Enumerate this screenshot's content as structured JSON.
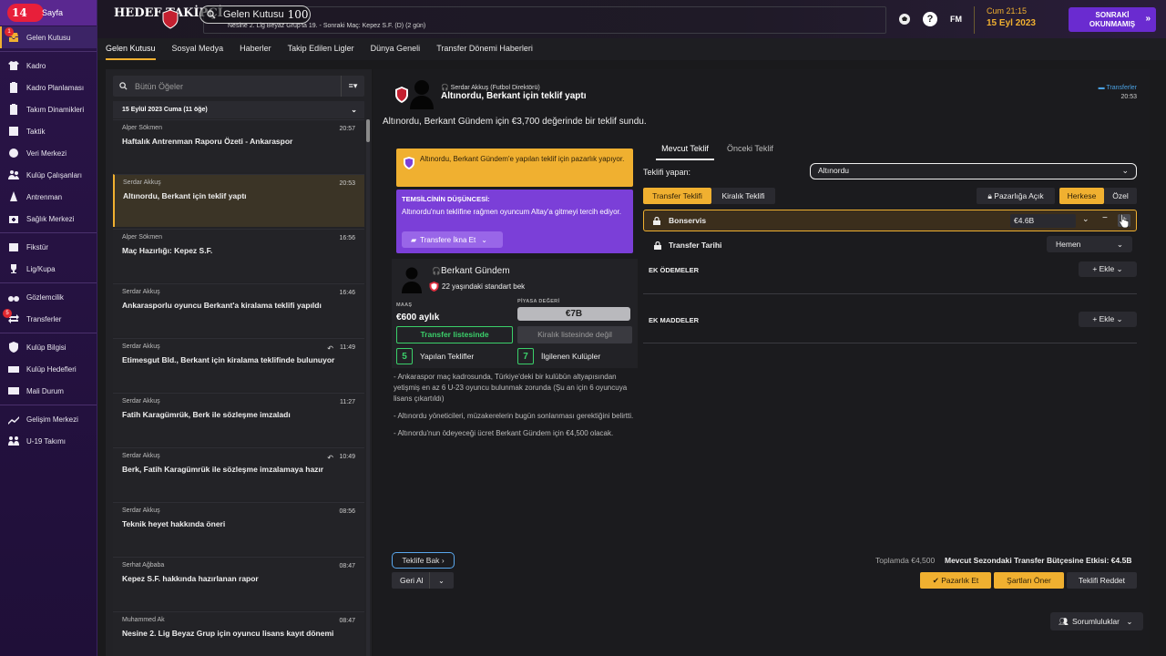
{
  "sidebar": {
    "page_badge": "14",
    "page_label": "Sayfa",
    "items": [
      {
        "label": "Gelen Kutusu",
        "icon": "inbox-icon",
        "badge": "1",
        "active": true
      },
      {
        "label": "Kadro",
        "icon": "shirt-icon"
      },
      {
        "label": "Kadro Planlaması",
        "icon": "clipboard-icon"
      },
      {
        "label": "Takım Dinamikleri",
        "icon": "clipboard-icon"
      },
      {
        "label": "Taktik",
        "icon": "tactics-board-icon"
      },
      {
        "label": "Veri Merkezi",
        "icon": "globe-icon"
      },
      {
        "label": "Kulüp Çalışanları",
        "icon": "staff-icon"
      },
      {
        "label": "Antrenman",
        "icon": "cone-icon"
      },
      {
        "label": "Sağlık Merkezi",
        "icon": "medical-icon"
      },
      {
        "label": "Fikstür",
        "icon": "calendar-icon"
      },
      {
        "label": "Lig/Kupa",
        "icon": "trophy-icon"
      },
      {
        "label": "Gözlemcilik",
        "icon": "binoculars-icon"
      },
      {
        "label": "Transferler",
        "icon": "transfer-icon",
        "badge": "5"
      },
      {
        "label": "Kulüp Bilgisi",
        "icon": "shield-icon"
      },
      {
        "label": "Kulüp Hedefleri",
        "icon": "board-icon"
      },
      {
        "label": "Mali Durum",
        "icon": "finance-icon"
      },
      {
        "label": "Gelişim Merkezi",
        "icon": "development-icon"
      },
      {
        "label": "U-19 Takımı",
        "icon": "youth-icon"
      }
    ]
  },
  "topbar": {
    "title": "HEDEF TAKİPÇİ",
    "search_label": "Gelen Kutusu",
    "search_count": "100",
    "subtitle": "Nesine 2. Lig Beyaz Grup'ta 19. - Sonraki Maç: Kepez S.F. (D) (2 gün)",
    "fm_label": "FM",
    "time": "Cum 21:15",
    "date": "15 Eyl 2023",
    "next_button": "SONRAKİ OKUNMAMIŞ",
    "accent": "#f0b030",
    "next_color": "#6a2bd0"
  },
  "tabs": [
    "Gelen Kutusu",
    "Sosyal Medya",
    "Haberler",
    "Takip Edilen Ligler",
    "Dünya Geneli",
    "Transfer Dönemi Haberleri"
  ],
  "inbox": {
    "search_placeholder": "Bütün Öğeler",
    "date_header": "15 Eylül 2023 Cuma (11 öğe)",
    "messages": [
      {
        "from": "Alper Sökmen",
        "time": "20:57",
        "subject": "Haftalık Antrenman Raporu Özeti - Ankaraspor"
      },
      {
        "from": "Serdar Akkuş",
        "time": "20:53",
        "subject": "Altınordu, Berkant için teklif yaptı",
        "selected": true
      },
      {
        "from": "Alper Sökmen",
        "time": "16:56",
        "subject": "Maç Hazırlığı: Kepez S.F."
      },
      {
        "from": "Serdar Akkuş",
        "time": "16:46",
        "subject": "Ankarasporlu oyuncu Berkant'a kiralama teklifi yapıldı"
      },
      {
        "from": "Serdar Akkuş",
        "time": "11:49",
        "subject": "Etimesgut Bld., Berkant için kiralama teklifinde bulunuyor",
        "forward": true
      },
      {
        "from": "Serdar Akkuş",
        "time": "11:27",
        "subject": "Fatih Karagümrük, Berk ile sözleşme imzaladı"
      },
      {
        "from": "Serdar Akkuş",
        "time": "10:49",
        "subject": "Berk, Fatih Karagümrük ile sözleşme imzalamaya hazır",
        "forward": true
      },
      {
        "from": "Serdar Akkuş",
        "time": "08:56",
        "subject": "Teknik heyet hakkında öneri"
      },
      {
        "from": "Serhat Ağbaba",
        "time": "08:47",
        "subject": "Kepez S.F. hakkında hazırlanan rapor"
      },
      {
        "from": "Muhammed Ak",
        "time": "08:47",
        "subject": "Nesine 2. Lig Beyaz Grup için oyuncu lisans kayıt dönemi"
      }
    ]
  },
  "detail": {
    "from": "Serdar Akkuş  (Futbol Direktörü)",
    "subject": "Altınordu, Berkant için teklif yaptı",
    "category": "Transferler",
    "time": "20:53",
    "body": "Altınordu, Berkant Gündem için €3,700 değerinde bir teklif sundu.",
    "orange_card": "Altınordu, Berkant Gündem'e yapılan teklif için pazarlık yapıyor.",
    "agent_title": "TEMSİLCİNİN DÜŞÜNCESİ:",
    "agent_text": "Altınordu'nun teklifine rağmen oyuncum Altay'a gitmeyi tercih ediyor.",
    "persuade_button": "Transfere İkna Et",
    "player": {
      "name": "Berkant Gündem",
      "desc": "22 yaşındaki standart bek",
      "wage_label": "MAAŞ",
      "wage": "€600 aylık",
      "value_label": "PİYASA DEĞERİ",
      "value": "€7B",
      "transfer_listed": "Transfer listesinde",
      "loan_listed": "Kiralık listesinde değil",
      "offers_count": "5",
      "offers_label": "Yapılan Teklifler",
      "clubs_count": "7",
      "clubs_label": "İlgilenen Kulüpler"
    },
    "notes": [
      "- Ankaraspor maç kadrosunda, Türkiye'deki bir kulübün altyapısından yetişmiş en az 6 U-23 oyuncu bulunmak zorunda (Şu an için 6 oyuncuya lisans çıkartıldı)",
      "- Altınordu yöneticileri, müzakerelerin bugün sonlanması gerektiğini belirtti.",
      "- Altınordu'nun ödeyeceği ücret Berkant Gündem için €4,500 olacak."
    ],
    "view_offer": "Teklife Bak",
    "withdraw": "Geri Al"
  },
  "offer": {
    "tab_current": "Mevcut Teklif",
    "tab_previous": "Önceki Teklif",
    "maker_label": "Teklifi yapan:",
    "maker_value": "Altınordu",
    "type_transfer": "Transfer Teklifi",
    "type_loan": "Kiralık Teklifi",
    "negotiable": "Pazarlığa Açık",
    "public": "Herkese",
    "private": "Özel",
    "fee_label": "Bonservis",
    "fee_value": "€4.6B",
    "date_label": "Transfer Tarihi",
    "date_value": "Hemen",
    "extra_payments": "EK ÖDEMELER",
    "extra_clauses": "EK MADDELER",
    "add": "Ekle",
    "total": "Toplamda €4,500",
    "budget": "Mevcut Sezondaki Transfer Bütçesine Etkisi: €4.5B",
    "negotiate": "Pazarlık Et",
    "propose": "Şartları Öner",
    "reject": "Teklifi Reddet",
    "responsibilities": "Sorumluluklar"
  }
}
